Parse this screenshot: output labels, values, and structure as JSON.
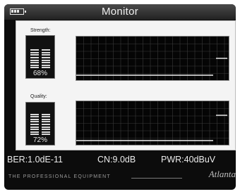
{
  "titlebar": {
    "title": "Monitor",
    "battery_icon": "battery-icon"
  },
  "strength": {
    "label": "Strength:",
    "percent_text": "68%",
    "level": 0.68
  },
  "quality": {
    "label": "Quality:",
    "percent_text": "72%",
    "level": 0.72
  },
  "stats": {
    "ber": "BER:1.0dE-11",
    "cn": "CN:9.0dB",
    "pwr": "PWR:40dBuV"
  },
  "footer": {
    "tagline": "THE PROFESSIONAL EQUIPMENT",
    "brand": "Atlanta"
  },
  "colors": {
    "screen_bg": "#0c0c0c",
    "panel_bg": "#f4f4f4",
    "text": "#ececec"
  }
}
